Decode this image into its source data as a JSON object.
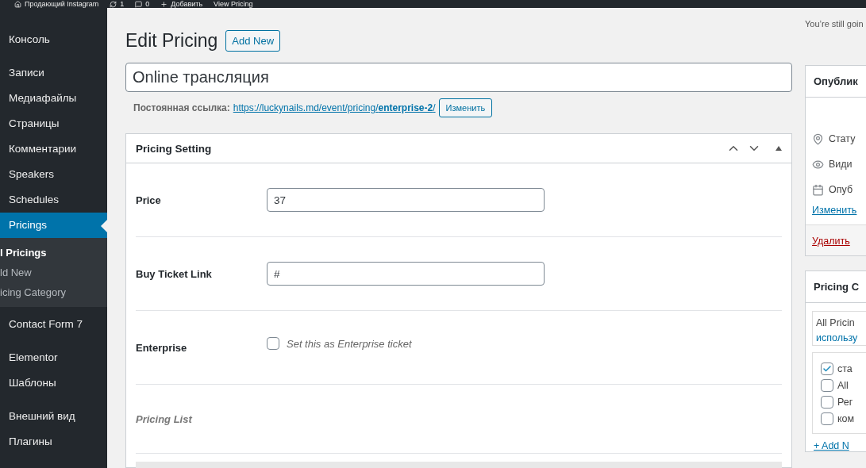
{
  "admin_bar": {
    "site": "Продающий Instagram",
    "updates": "1",
    "comments": "0",
    "add": "Добавить",
    "view": "View Pricing"
  },
  "sidebar": {
    "items": [
      {
        "label": "Консоль",
        "selected": false
      },
      {
        "label": "Записи",
        "selected": false
      },
      {
        "label": "Медиафайлы",
        "selected": false
      },
      {
        "label": "Страницы",
        "selected": false
      },
      {
        "label": "Комментарии",
        "selected": false
      },
      {
        "label": "Speakers",
        "selected": false
      },
      {
        "label": "Schedules",
        "selected": false
      },
      {
        "label": "Pricings",
        "selected": true,
        "children": [
          {
            "label": "l Pricings",
            "selected": true
          },
          {
            "label": "ld New",
            "selected": false
          },
          {
            "label": "icing Category",
            "selected": false
          }
        ]
      },
      {
        "label": "Contact Form 7",
        "selected": false
      },
      {
        "label": "Elementor",
        "selected": false
      },
      {
        "label": "Шаблоны",
        "selected": false
      },
      {
        "label": "Внешний вид",
        "selected": false
      },
      {
        "label": "Плагины",
        "selected": false
      }
    ]
  },
  "notice": "You’re still goin",
  "heading": "Edit Pricing",
  "add_new": "Add New",
  "title_value": "Online трансляция",
  "permalink": {
    "label": "Постоянная ссылка:",
    "url": "https://luckynails.md/event/pricing/**enterprise-2**/",
    "edit": "Изменить"
  },
  "metabox": {
    "title": "Pricing Setting",
    "fields": [
      {
        "kind": "input",
        "label": "Price",
        "value": "37"
      },
      {
        "kind": "input",
        "label": "Buy Ticket Link",
        "value": "#"
      },
      {
        "kind": "checkbox",
        "label": "Enterprise",
        "checked": false,
        "text": "Set this as Enterprise ticket"
      },
      {
        "kind": "heading",
        "label": "Pricing List"
      }
    ]
  },
  "publish": {
    "title": "Опублик",
    "rows": [
      {
        "kind": "pin",
        "text": "Стату"
      },
      {
        "kind": "eye",
        "text": "Види"
      },
      {
        "kind": "calendar",
        "text": "Опуб"
      }
    ],
    "edit": "Изменить",
    "delete": "Удалить"
  },
  "categories": {
    "title": "Pricing C",
    "tab": "All Pricin",
    "tab2": "использу",
    "items": [
      {
        "label": "ста",
        "checked": true
      },
      {
        "label": "All",
        "checked": false
      },
      {
        "label": "Рег",
        "checked": false
      },
      {
        "label": "ком",
        "checked": false
      }
    ],
    "add": "+ Add N"
  }
}
